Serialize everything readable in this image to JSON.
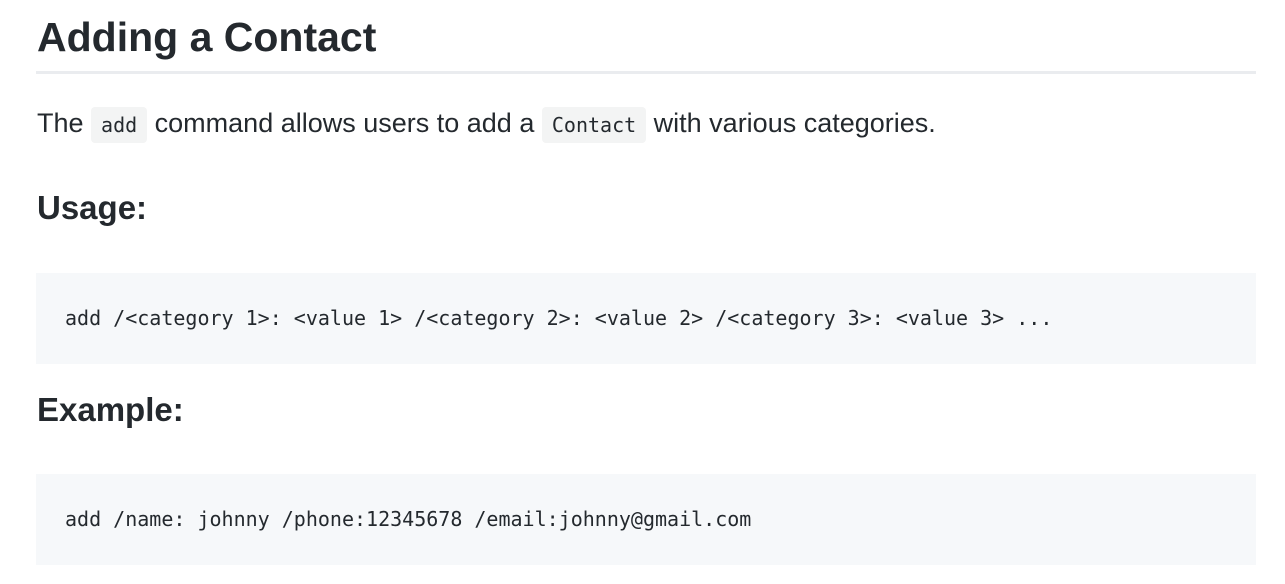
{
  "heading": "Adding a Contact",
  "intro": {
    "text_before": "The ",
    "code_add": "add",
    "text_middle": " command allows users to add a ",
    "code_contact": "Contact",
    "text_after": " with various categories."
  },
  "usage": {
    "heading": "Usage:",
    "code": "add /<category 1>: <value 1> /<category 2>: <value 2> /<category 3>: <value 3> ..."
  },
  "example": {
    "heading": "Example:",
    "code": "add /name: johnny /phone:12345678 /email:johnny@gmail.com"
  }
}
